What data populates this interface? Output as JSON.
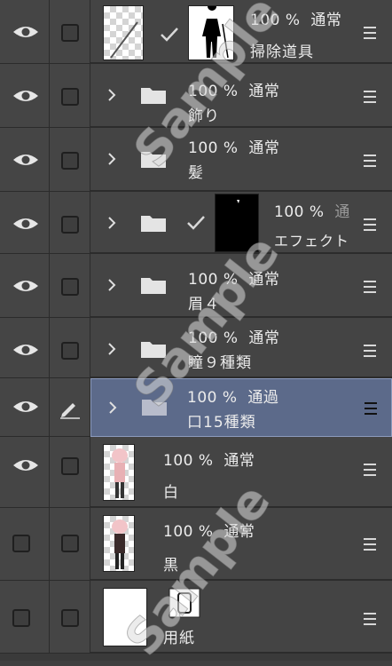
{
  "layers": [
    {
      "opacity": "100 %",
      "blend": "通常",
      "name": "掃除道具",
      "visible": true,
      "type": "image",
      "has_mask": true,
      "mask_check": true
    },
    {
      "opacity": "100 %",
      "blend": "通常",
      "name": "飾り",
      "visible": true,
      "type": "folder"
    },
    {
      "opacity": "100 %",
      "blend": "通常",
      "name": "髪",
      "visible": true,
      "type": "folder"
    },
    {
      "opacity": "100 %",
      "blend": "通",
      "name": "エフェクト",
      "visible": true,
      "type": "folder",
      "has_mask": true,
      "mask_check": true
    },
    {
      "opacity": "100 %",
      "blend": "通常",
      "name": "眉４",
      "visible": true,
      "type": "folder"
    },
    {
      "opacity": "100 %",
      "blend": "通常",
      "name": "瞳９種類",
      "visible": true,
      "type": "folder"
    },
    {
      "opacity": "100 %",
      "blend": "通過",
      "name": "口15種類",
      "visible": true,
      "type": "folder",
      "active": true
    },
    {
      "opacity": "100 %",
      "blend": "通常",
      "name": "白",
      "visible": true,
      "type": "image"
    },
    {
      "opacity": "100 %",
      "blend": "通常",
      "name": "黒",
      "visible": false,
      "type": "image"
    },
    {
      "opacity": "",
      "blend": "",
      "name": "用紙",
      "visible": false,
      "type": "paper"
    }
  ],
  "watermark": "Sample",
  "colors": {
    "active_row": "#5c6a8a",
    "panel_bg": "#444444",
    "text": "#ececec"
  }
}
